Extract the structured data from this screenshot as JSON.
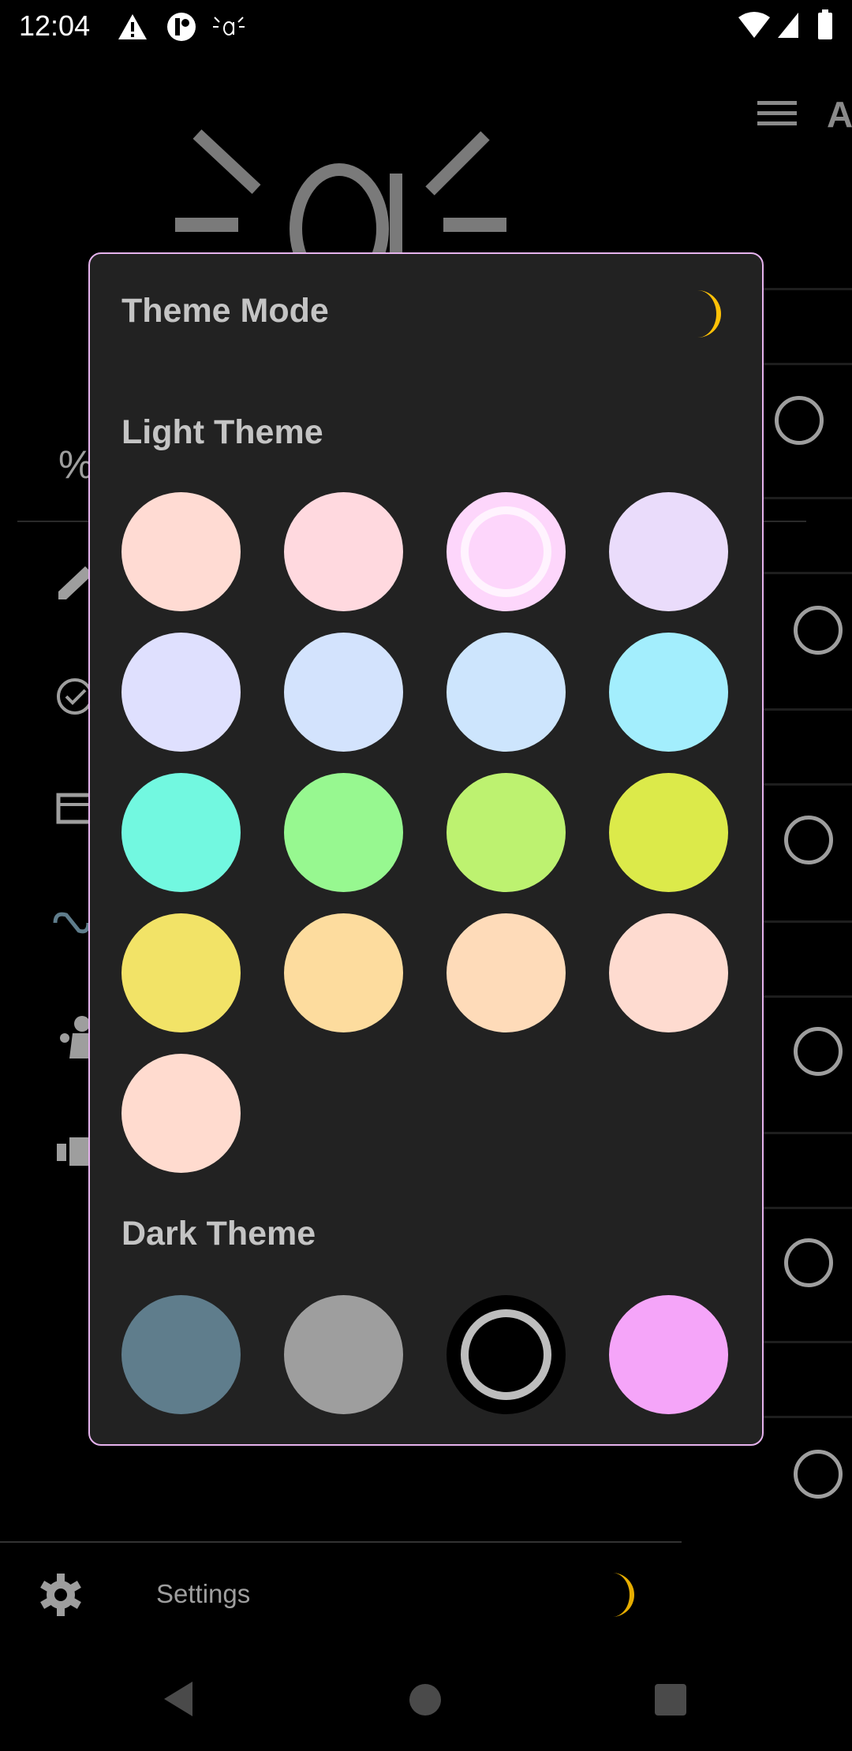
{
  "status_bar": {
    "time": "12:04",
    "icons": [
      "warning-icon",
      "app-notification-icon",
      "app-logo-icon",
      "wifi-icon",
      "signal-icon",
      "battery-icon"
    ]
  },
  "header": {
    "menu_icon": "hamburger-menu-icon",
    "title_partial": "A"
  },
  "drawer": {
    "icons": [
      "percent-icon",
      "pencil-icon",
      "check-circle-icon",
      "gift-calendar-icon",
      "infinity-icon",
      "figure-icon",
      "toggle-icon"
    ],
    "settings_label": "Settings"
  },
  "dialog": {
    "title": "Theme Mode",
    "mode_icon": "moon-icon",
    "light_title": "Light Theme",
    "dark_title": "Dark Theme",
    "light_swatches": [
      {
        "color": "#ffdbd3",
        "selected": false
      },
      {
        "color": "#ffd9df",
        "selected": false
      },
      {
        "color": "#fdd6fb",
        "selected": true
      },
      {
        "color": "#eadcfb",
        "selected": false
      },
      {
        "color": "#dfe0fe",
        "selected": false
      },
      {
        "color": "#d3e3fd",
        "selected": false
      },
      {
        "color": "#cde5fd",
        "selected": false
      },
      {
        "color": "#a3eefd",
        "selected": false
      },
      {
        "color": "#72f8e0",
        "selected": false
      },
      {
        "color": "#97f890",
        "selected": false
      },
      {
        "color": "#bdf270",
        "selected": false
      },
      {
        "color": "#dcea4a",
        "selected": false
      },
      {
        "color": "#f2e367",
        "selected": false
      },
      {
        "color": "#fddc9e",
        "selected": false
      },
      {
        "color": "#fedbb9",
        "selected": false
      },
      {
        "color": "#fedbd0",
        "selected": false
      },
      {
        "color": "#ffdbcf",
        "selected": false
      }
    ],
    "dark_swatches": [
      {
        "color": "#5f7d8c",
        "selected": false
      },
      {
        "color": "#9e9e9e",
        "selected": false
      },
      {
        "color": "#000000",
        "selected": true
      },
      {
        "color": "#f5a5f9",
        "selected": false
      }
    ]
  },
  "colors": {
    "accent": "#ffc107",
    "dialog_border": "#e6b3ee",
    "dialog_bg": "#222222"
  }
}
